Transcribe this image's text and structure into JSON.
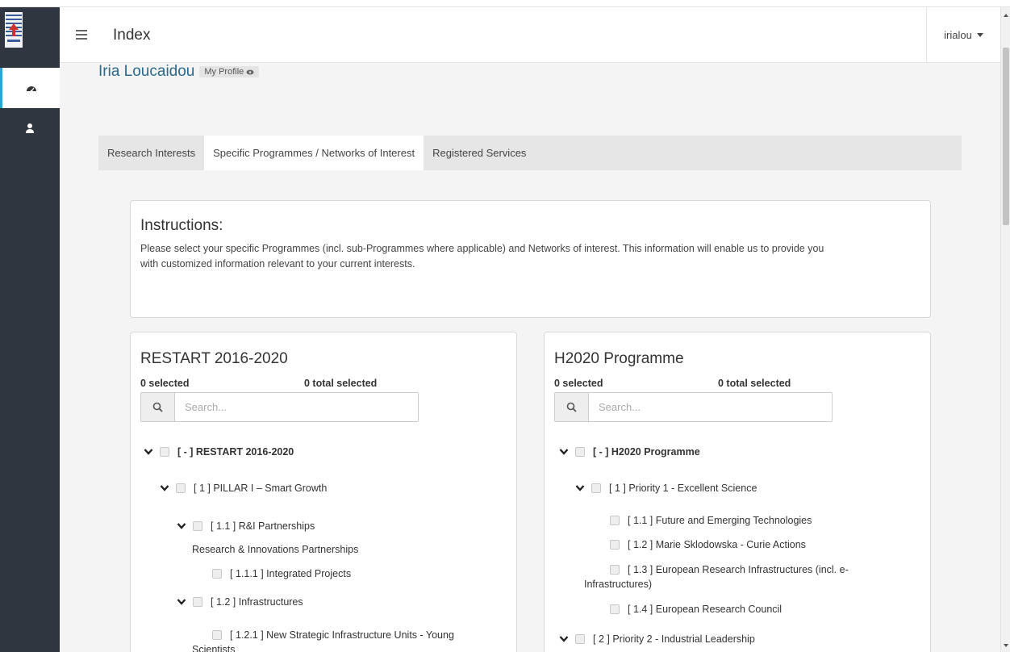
{
  "header": {
    "title": "Index",
    "user": "irialou"
  },
  "profile": {
    "name": "Iria Loucaidou",
    "button_label": "My Profile"
  },
  "tabs": [
    {
      "label": "Research Interests",
      "active": false
    },
    {
      "label": "Specific Programmes / Networks of Interest",
      "active": true
    },
    {
      "label": "Registered Services",
      "active": false
    }
  ],
  "instructions": {
    "title": "Instructions:",
    "line1": "Please select your specific Programmes (incl. sub-Programmes where applicable) and Networks of interest. This information will enable us to provide you",
    "line2": "with customized information relevant to your current interests."
  },
  "panels": {
    "left": {
      "title": "RESTART 2016-2020",
      "selected": "0 selected",
      "total_selected": "0 total selected",
      "search_placeholder": "Search...",
      "tree": {
        "root": "[ - ] RESTART 2016-2020",
        "n1": "[ 1 ] PILLAR I – Smart Growth",
        "n11": "[ 1.1 ] R&I Partnerships",
        "n11_desc": "Research & Innovations Partnerships",
        "n111": "[ 1.1.1 ] Integrated Projects",
        "n12": "[ 1.2 ] Infrastructures",
        "n121_a": "[ 1.2.1 ] New Strategic Infrastructure Units - Young",
        "n121_b": "Scientists"
      }
    },
    "right": {
      "title": "H2020 Programme",
      "selected": "0 selected",
      "total_selected": "0 total selected",
      "search_placeholder": "Search...",
      "tree": {
        "root": "[ - ] H2020 Programme",
        "p1": "[ 1 ] Priority 1 - Excellent Science",
        "p11": "[ 1.1 ] Future and Emerging Technologies",
        "p12": "[ 1.2 ] Marie Sklodowska - Curie Actions",
        "p13_a": "[ 1.3 ] European Research Infrastructures (incl. e-",
        "p13_b": "Infrastructures)",
        "p14": "[ 1.4 ] European Research Council",
        "p2": "[ 2 ] Priority 2 - Industrial Leadership"
      }
    }
  },
  "colors": {
    "sidebar": "#2f3640",
    "accent": "#2aa5d6",
    "link": "#2a6a8c"
  },
  "icons": [
    "menu-icon",
    "dashboard-icon",
    "user-icon",
    "search-icon",
    "chevron-down-icon",
    "eye-icon"
  ]
}
